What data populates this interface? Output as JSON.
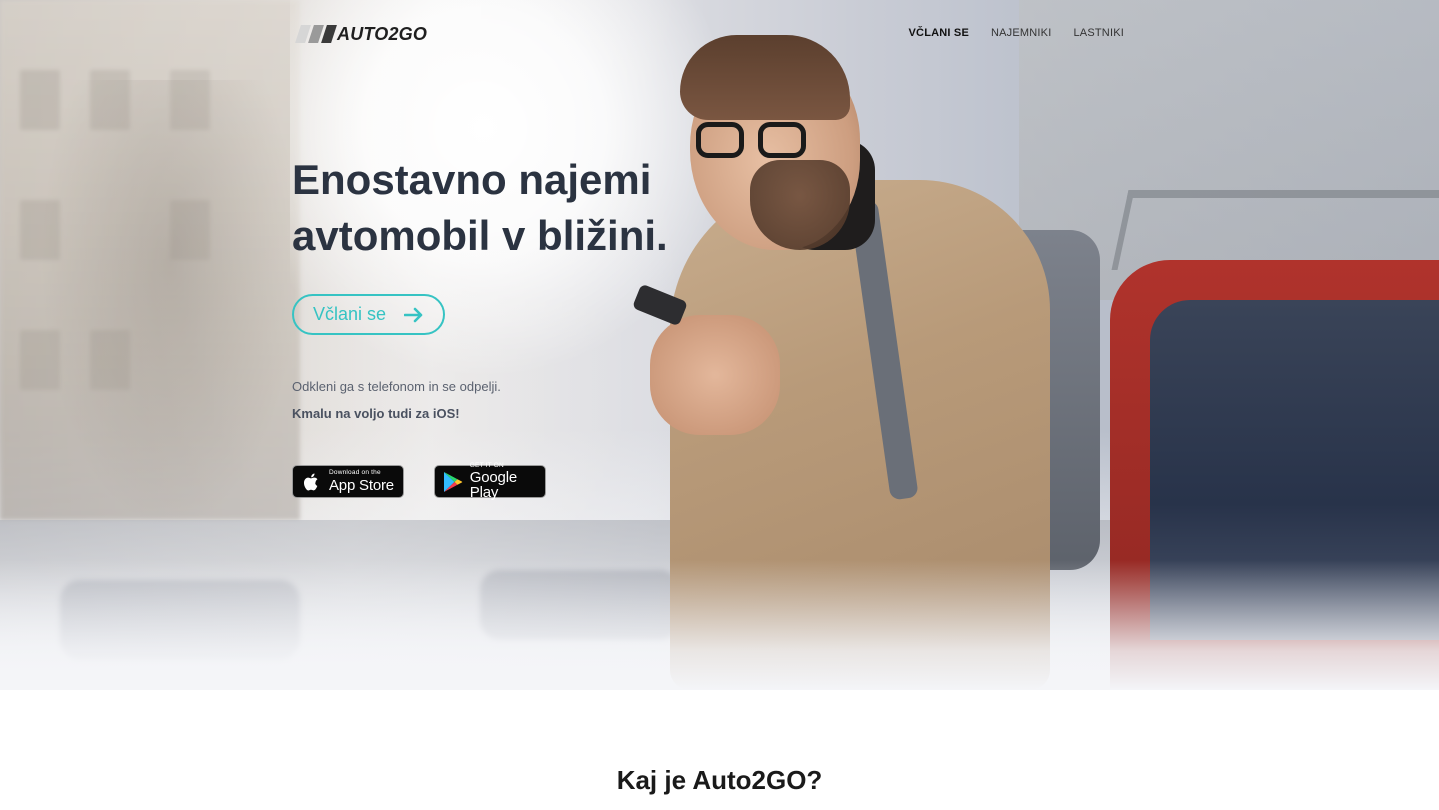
{
  "brand": {
    "logo_text": "AUTO2GO",
    "bar_colors": [
      "#d6d6d6",
      "#9a9a9a",
      "#3a3a3a"
    ]
  },
  "nav": {
    "items": [
      {
        "label": "VČLANI SE",
        "active": true
      },
      {
        "label": "NAJEMNIKI",
        "active": false
      },
      {
        "label": "LASTNIKI",
        "active": false
      }
    ]
  },
  "hero": {
    "headline_line1": "Enostavno najemi",
    "headline_line2": "avtomobil v bližini.",
    "cta_label": "Včlani se",
    "cta_icon": "arrow-right-icon",
    "subtext": "Odkleni ga s telefonom in se odpelji.",
    "ios_note": "Kmalu na voljo tudi za iOS!"
  },
  "store_badges": {
    "apple": {
      "small": "Download on the",
      "big": "App Store",
      "icon": "apple-icon"
    },
    "google": {
      "small": "GET IT ON",
      "big": "Google Play",
      "icon": "google-play-icon"
    }
  },
  "section": {
    "title": "Kaj je Auto2GO?"
  },
  "colors": {
    "accent": "#36c3c3",
    "headline": "#2b3341",
    "car_red": "#b0332c"
  }
}
